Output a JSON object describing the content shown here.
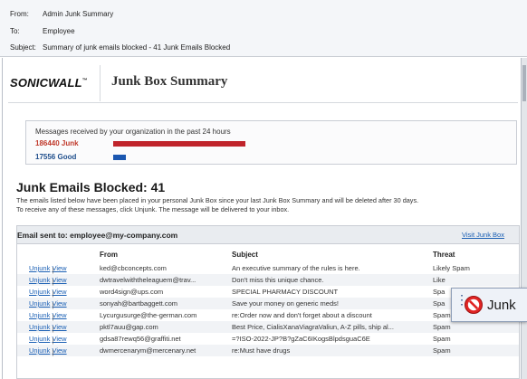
{
  "email_header": {
    "from_key": "From:",
    "from_value": "Admin Junk Summary",
    "to_key": "To:",
    "to_value": "Employee",
    "subject_key": "Subject:",
    "subject_value": "Summary of junk emails blocked - 41 Junk Emails Blocked"
  },
  "brand": {
    "logo_text": "SONICWALL",
    "logo_mark": "™",
    "title": "Junk Box Summary"
  },
  "stats": {
    "title": "Messages received by your organization in the past 24 hours",
    "junk_label": "186440 Junk",
    "junk_value": 186440,
    "good_label": "17556 Good",
    "good_value": 17556,
    "colors": {
      "junk": "#c0242b",
      "good": "#1b57b0"
    }
  },
  "blocked": {
    "title": "Junk Emails Blocked: 41",
    "desc_line1": "The emails listed below have been placed in your personal Junk Box since your last Junk Box Summary and will be deleted after 30 days.",
    "desc_line2": "To receive any of these messages, click Unjunk. The message will be delivered to your inbox."
  },
  "table": {
    "sent_to": "Email sent to: employee@my-company.com",
    "visit_link": "Visit Junk Box",
    "columns": {
      "from": "From",
      "subject": "Subject",
      "threat": "Threat"
    },
    "action_unjunk": "Unjunk",
    "action_sep": "|",
    "action_view": "View",
    "rows": [
      {
        "from": "ked@cbconcepts.com",
        "subject": "An executive summary of the rules is here.",
        "threat": "Likely Spam"
      },
      {
        "from": "dwtravelwiththeleaguem@trav...",
        "subject": "Don't miss this unique chance.",
        "threat": "Like"
      },
      {
        "from": "word4sign@ups.com",
        "subject": "SPECIAL PHARMACY DISCOUNT",
        "threat": "Spa"
      },
      {
        "from": "sonyah@bartbaggett.com",
        "subject": "Save your money on generic meds!",
        "threat": "Spa"
      },
      {
        "from": "Lycurgusurge@the-german.com",
        "subject": "re:Order now and don't forget about a discount",
        "threat": "Spam"
      },
      {
        "from": "pktl7auu@gap.com",
        "subject": "Best Price, CialisXanaViagraValiun, A-Z pills, ship al...",
        "threat": "Spam"
      },
      {
        "from": "gdsa87rewq56@graffiti.net",
        "subject": "=?ISO-2022-JP?B?gZaC6IKogsBlpdsguaC6E",
        "threat": "Spam"
      },
      {
        "from": "dwmercenarym@mercenary.net",
        "subject": "re:Must have drugs",
        "threat": "Spam"
      }
    ]
  },
  "popup": {
    "label": "Junk",
    "icon": "no-entry-icon"
  }
}
